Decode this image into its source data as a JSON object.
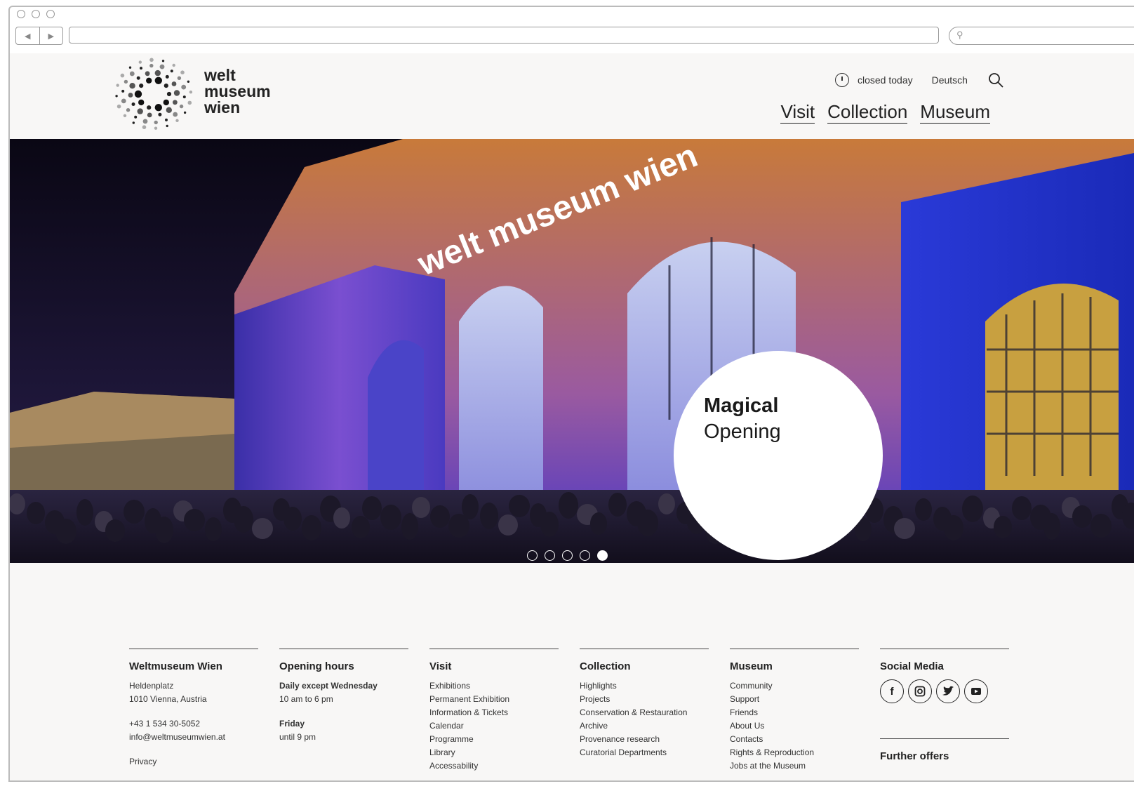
{
  "site": {
    "logo_lines": [
      "welt",
      "museum",
      "wien"
    ],
    "hours_status": "closed today",
    "language": "Deutsch"
  },
  "nav": [
    "Visit",
    "Collection",
    "Museum"
  ],
  "hero": {
    "facade_text": "welt museum wien",
    "title": "Magical",
    "subtitle": "Opening",
    "slides": 5,
    "active_slide": 5
  },
  "footer": {
    "about": {
      "title": "Weltmuseum Wien",
      "address1": "Heldenplatz",
      "address2": "1010 Vienna, Austria",
      "phone": "+43 1 534 30-5052",
      "email": "info@weltmuseumwien.at",
      "privacy": "Privacy"
    },
    "hours": {
      "title": "Opening hours",
      "label1": "Daily except Wednesday",
      "time1": "10 am to 6 pm",
      "label2": "Friday",
      "time2": "until 9 pm"
    },
    "visit": {
      "title": "Visit",
      "items": [
        "Exhibitions",
        "Permanent Exhibition",
        "Information & Tickets",
        "Calendar",
        "Programme",
        "Library",
        "Accessability"
      ]
    },
    "collection": {
      "title": "Collection",
      "items": [
        "Highlights",
        "Projects",
        "Conservation & Restauration",
        "Archive",
        "Provenance research",
        "Curatorial Departments"
      ]
    },
    "museum": {
      "title": "Museum",
      "items": [
        "Community",
        "Support",
        "Friends",
        "About Us",
        "Contacts",
        "Rights & Reproduction",
        "Jobs at the Museum"
      ]
    },
    "social": {
      "title": "Social Media",
      "icons": [
        "facebook-icon",
        "instagram-icon",
        "twitter-icon",
        "youtube-icon"
      ]
    },
    "further": {
      "title": "Further offers"
    }
  }
}
